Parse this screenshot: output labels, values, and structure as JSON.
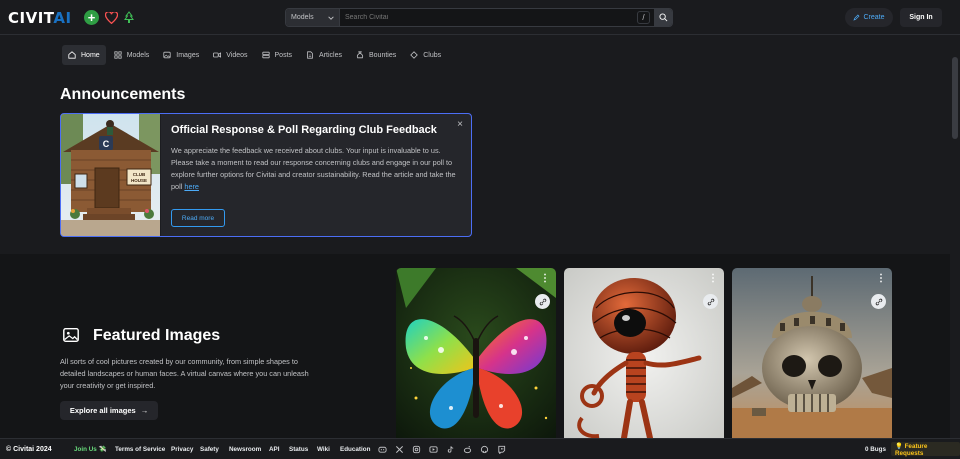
{
  "header": {
    "logo_main": "CIVIT",
    "logo_ai": "AI",
    "plus_label": "+",
    "search_select": "Models",
    "search_placeholder": "Search Civitai",
    "search_shortcut": "/",
    "create_label": "Create",
    "signin_label": "Sign In"
  },
  "nav": {
    "items": [
      {
        "label": "Home"
      },
      {
        "label": "Models"
      },
      {
        "label": "Images"
      },
      {
        "label": "Videos"
      },
      {
        "label": "Posts"
      },
      {
        "label": "Articles"
      },
      {
        "label": "Bounties"
      },
      {
        "label": "Clubs"
      }
    ]
  },
  "announcements": {
    "section_title": "Announcements",
    "card_title": "Official Response & Poll Regarding Club Feedback",
    "card_text": "We appreciate the feedback we received about clubs. Your input is invaluable to us. Please take a moment to read our response concerning clubs and engage in our poll to explore further options for Civitai and creator sustainability. Read the article and take the poll ",
    "card_link": "here",
    "read_more": "Read more",
    "close_glyph": "×",
    "image_sign": "CLUB HOUSE",
    "image_badge": "C"
  },
  "featured": {
    "title": "Featured Images",
    "description": "All sorts of cool pictures created by our community, from simple shapes to detailed landscapes or human faces. A virtual canvas where you can unleash your creativity or get inspired.",
    "explore_label": "Explore all images",
    "explore_arrow": "→",
    "card_menu_glyph": "⋮"
  },
  "footer": {
    "copyright": "© Civitai 2024",
    "join_us": "Join Us 💸",
    "links": [
      "Terms of Service",
      "Privacy",
      "Safety",
      "Newsroom",
      "API",
      "Status",
      "Wiki",
      "Education"
    ],
    "bugs": "0 Bugs",
    "feature_requests": "💡 Feature Requests"
  },
  "colors": {
    "background": "#1a1b1e",
    "accent_blue": "#4dabf7",
    "card_border": "#4c6ef5",
    "green": "#2f9e44",
    "feature_yellow": "#fcc419"
  }
}
